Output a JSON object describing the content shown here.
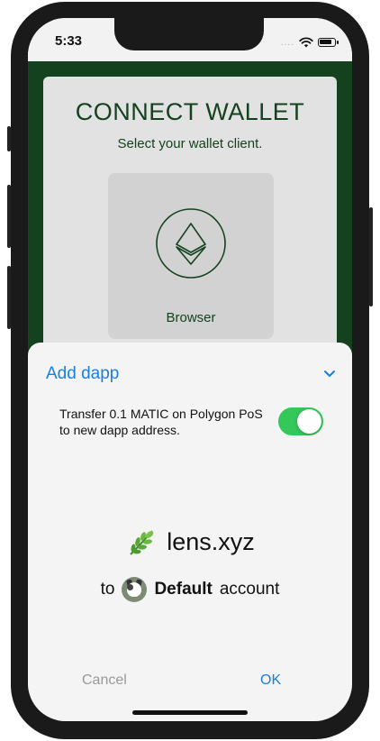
{
  "status_bar": {
    "time": "5:33",
    "dots": "....",
    "wifi_icon": "wifi-icon",
    "battery_icon": "battery-icon"
  },
  "card": {
    "title": "CONNECT WALLET",
    "subtitle": "Select your wallet client.",
    "wallet_option": {
      "label": "Browser",
      "icon": "ethereum-icon"
    }
  },
  "sheet": {
    "header": "Add dapp",
    "option_text": "Transfer 0.1 MATIC on Polygon PoS to new dapp address.",
    "toggle_on": true,
    "dapp_emoji_icon": "herb-leaf-icon",
    "dapp_name": "lens.xyz",
    "to_label": "to",
    "account_name": "Default",
    "account_label": "account",
    "cancel_label": "Cancel",
    "ok_label": "OK"
  },
  "colors": {
    "brand_green": "#14421f",
    "accent_blue": "#1a7fe0",
    "toggle_green": "#34c759"
  }
}
